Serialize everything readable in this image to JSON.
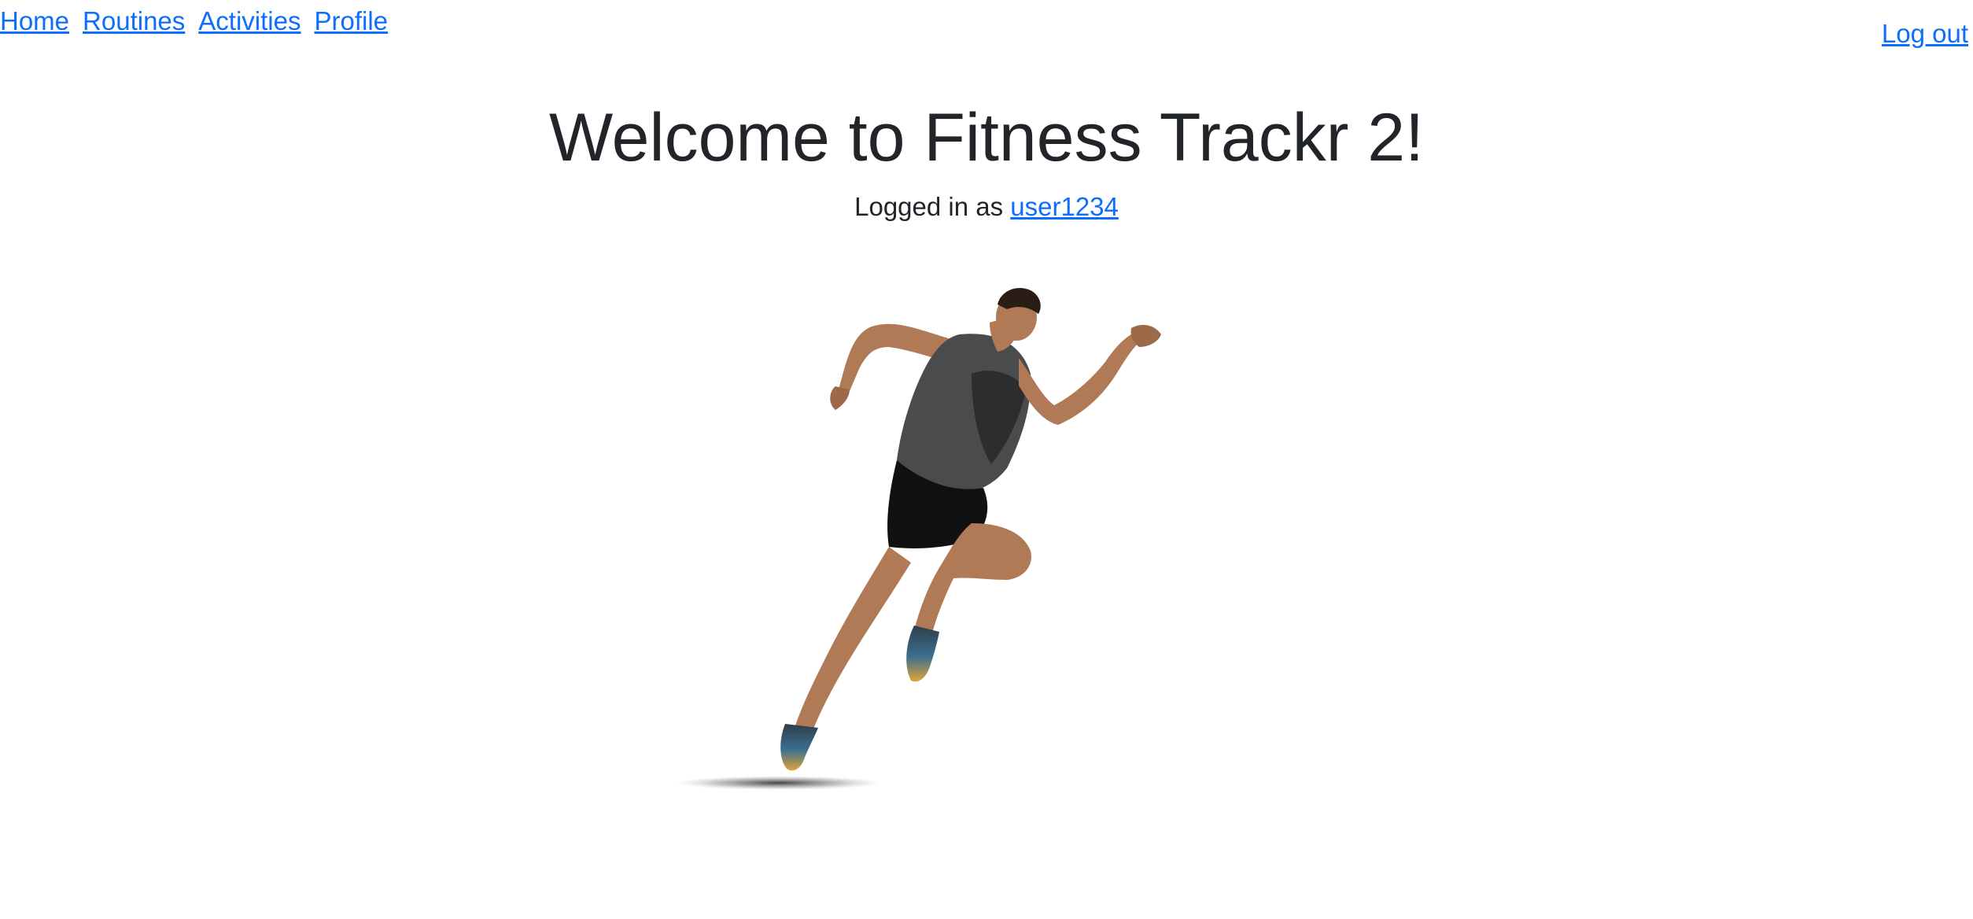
{
  "nav": {
    "links": [
      "Home",
      "Routines",
      "Activities",
      "Profile"
    ],
    "logout": "Log out"
  },
  "main": {
    "title": "Welcome to Fitness Trackr 2!",
    "logged_in_prefix": "Logged in as ",
    "username": "user1234"
  },
  "hero": {
    "icon": "sprinting-athlete-image"
  },
  "colors": {
    "link": "#0d6efd",
    "text": "#212529",
    "background": "#ffffff"
  }
}
